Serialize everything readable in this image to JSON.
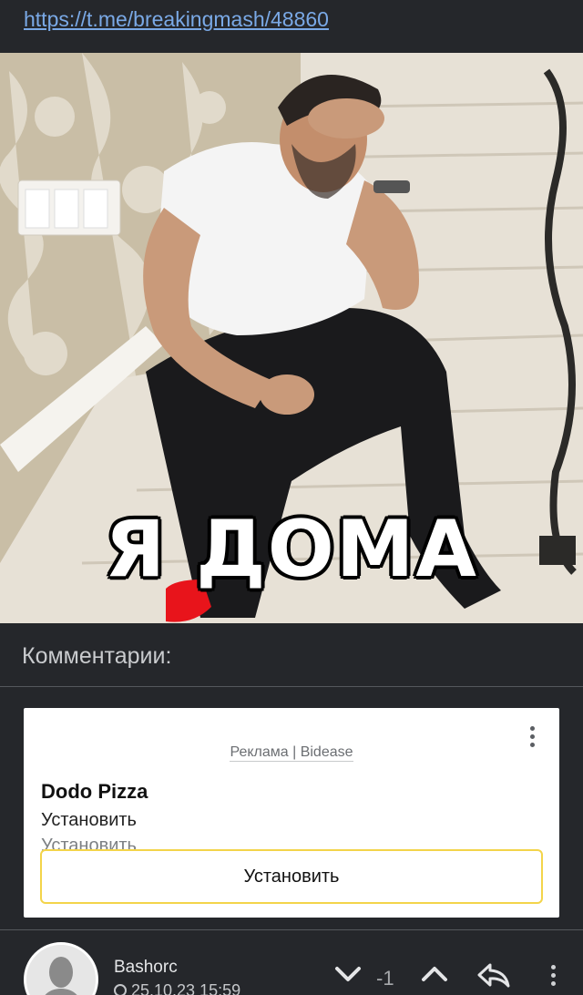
{
  "post": {
    "link": "https://t.me/breakingmash/48860",
    "image_caption": "Я ДОМА"
  },
  "comments": {
    "title": "Комментарии:"
  },
  "ad": {
    "label": "Реклама | Bidease",
    "title": "Dodo Pizza",
    "subtitle": "Установить",
    "description": "Установить",
    "button_label": "Установить"
  },
  "comment": {
    "username": "Bashorc",
    "date": "25.10.23 15:59",
    "score": "-1"
  }
}
